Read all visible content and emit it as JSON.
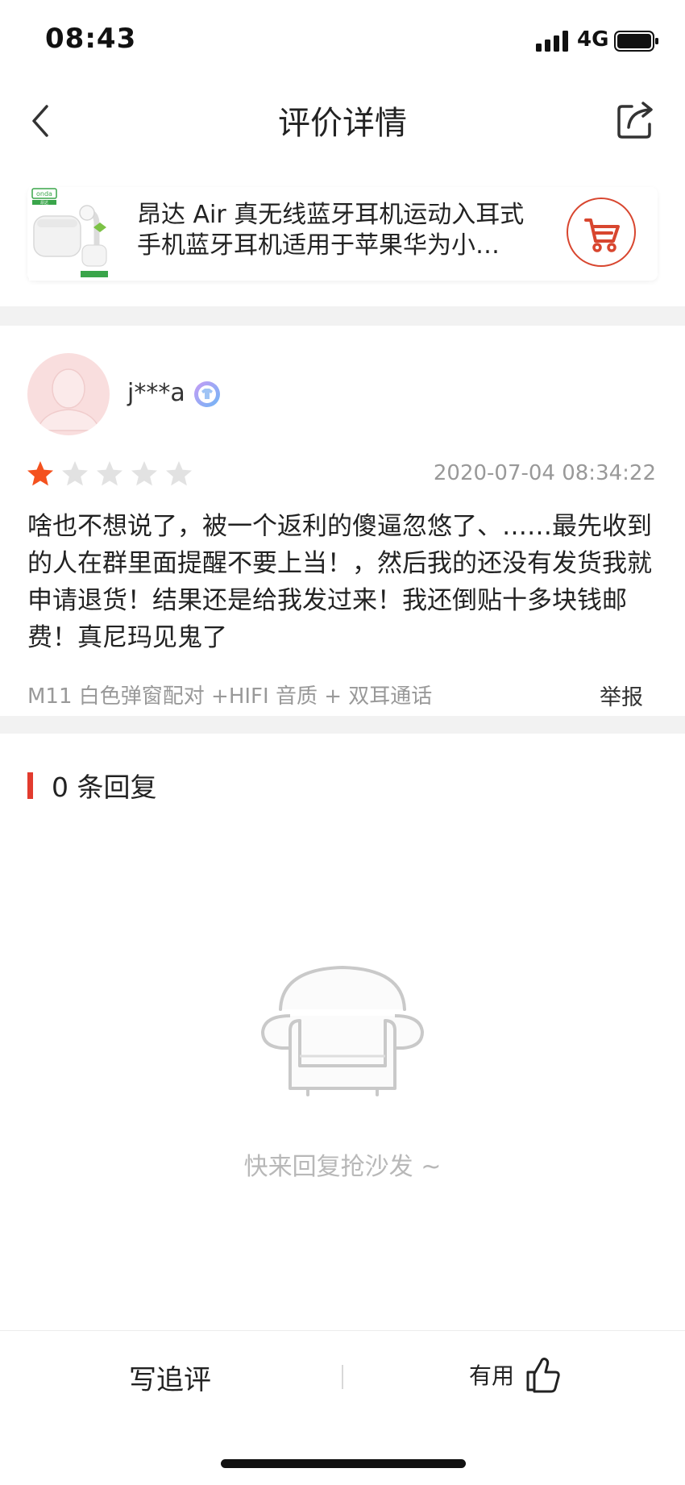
{
  "status_bar": {
    "time": "08:43",
    "network": "4G"
  },
  "nav": {
    "title": "评价详情",
    "back_icon": "chevron-left-icon",
    "share_icon": "share-icon"
  },
  "product": {
    "title": "昂达 Air 真无线蓝牙耳机运动入耳式手机蓝牙耳机适用于苹果华为小…",
    "cart_icon": "cart-icon",
    "thumb_brand": "onda",
    "thumb_caption": "昂达"
  },
  "review": {
    "username": "j***a",
    "rating": 1,
    "rating_max": 5,
    "date": "2020-07-04 08:34:22",
    "text": "啥也不想说了，被一个返利的傻逼忽悠了、……最先收到的人在群里面提醒不要上当！，然后我的还没有发货我就申请退货！结果还是给我发过来！我还倒贴十多块钱邮费！真尼玛见鬼了",
    "sku": "M11 白色弹窗配对 +HIFI 音质 + 双耳通话",
    "report_label": "举报"
  },
  "replies": {
    "count_label": "0 条回复",
    "empty_hint": "快来回复抢沙发 ~"
  },
  "bottom_bar": {
    "write_label": "写追评",
    "useful_label": "有用"
  },
  "colors": {
    "accent": "#e23b2e",
    "star_on": "#f4511e",
    "star_off": "#e2e2e2"
  }
}
